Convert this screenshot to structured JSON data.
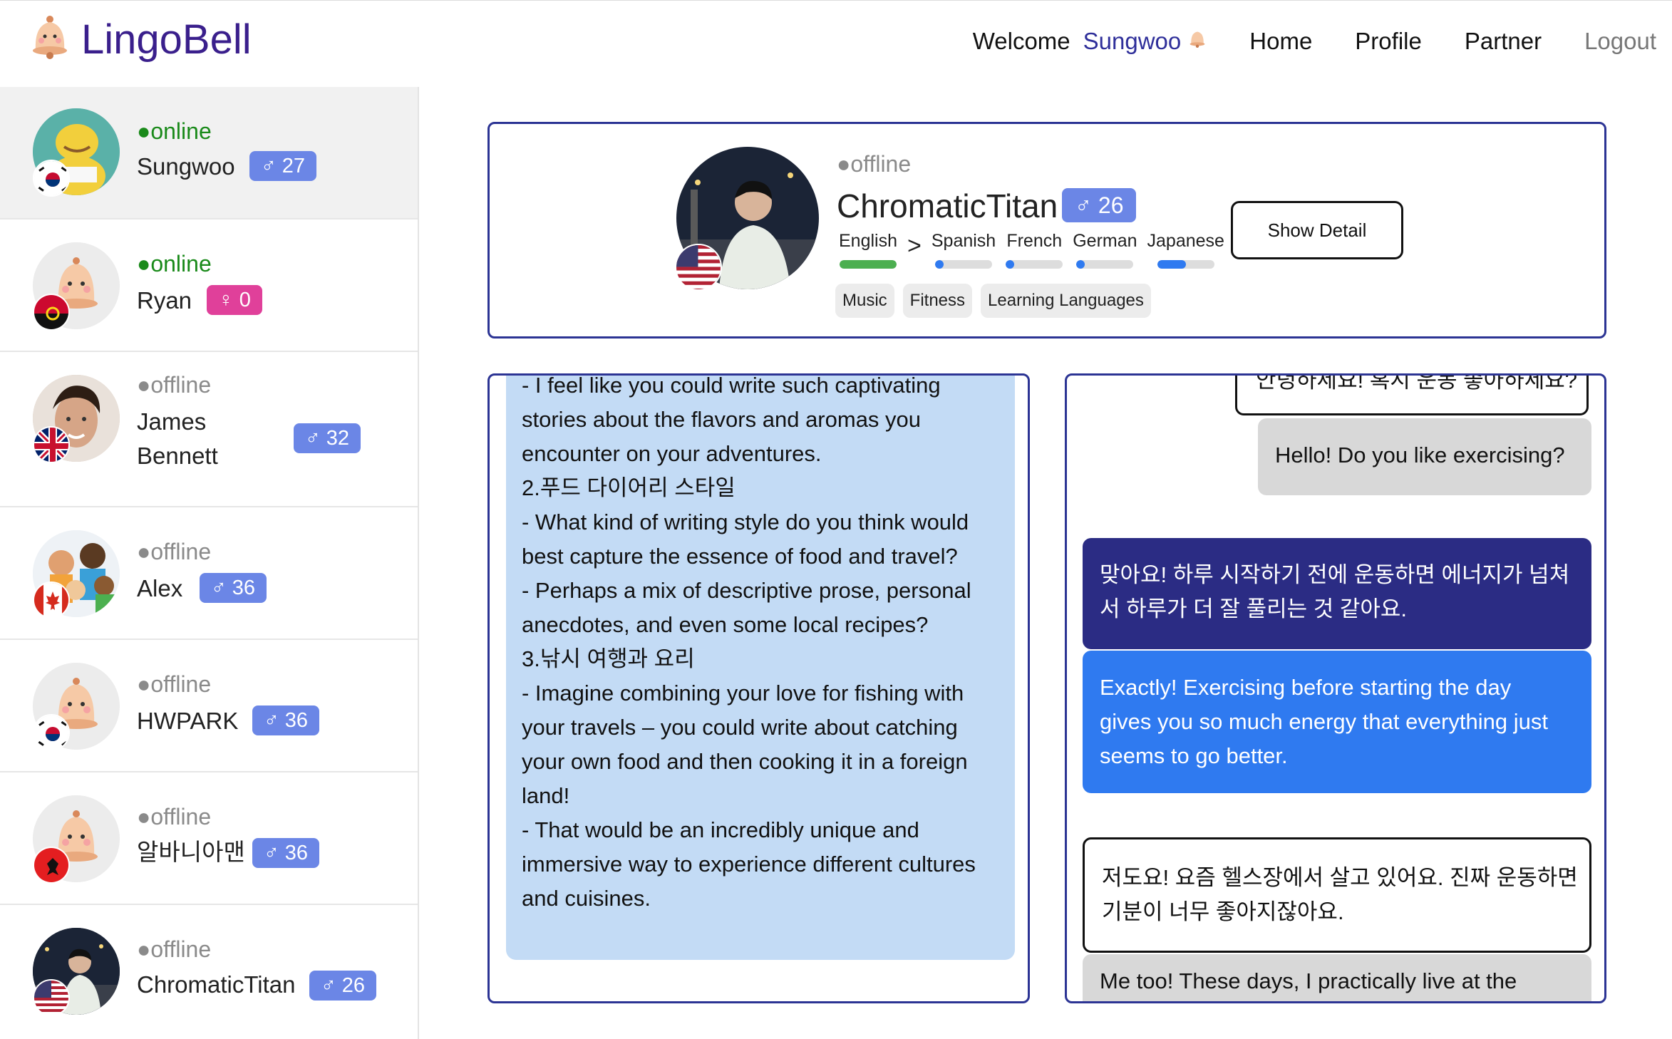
{
  "brand": {
    "name": "LingoBell",
    "logo_icon": "bell-icon"
  },
  "nav": {
    "welcome": "Welcome",
    "username": "Sungwoo",
    "home": "Home",
    "profile": "Profile",
    "partner": "Partner",
    "logout": "Logout"
  },
  "sidebar": {
    "items": [
      {
        "status": "●online",
        "name": "Sungwoo",
        "badge": "♂ 27",
        "flag": "korea"
      },
      {
        "status": "●online",
        "name": "Ryan",
        "badge": "♀ 0",
        "flag": "angola"
      },
      {
        "status": "●offline",
        "name": "James",
        "name2": "Bennett",
        "badge": "♂ 32",
        "flag": "uk"
      },
      {
        "status": "●offline",
        "name": "Alex",
        "badge": "♂ 36",
        "flag": "canada"
      },
      {
        "status": "●offline",
        "name": "HWPARK",
        "badge": "♂ 36",
        "flag": "korea"
      },
      {
        "status": "●offline",
        "name": "알바니아맨",
        "badge": "♂ 36",
        "flag": "albania"
      },
      {
        "status": "●offline",
        "name": "ChromaticTitan",
        "badge": "♂ 26",
        "flag": "usa"
      }
    ]
  },
  "partner": {
    "status": "●offline",
    "name": "ChromaticTitan",
    "badge": "♂ 26",
    "native_language": {
      "name": "English",
      "level": 1.0
    },
    "arrow": ">",
    "learning_languages": [
      {
        "name": "Spanish",
        "level": 0.15
      },
      {
        "name": "French",
        "level": 0.15
      },
      {
        "name": "German",
        "level": 0.15
      },
      {
        "name": "Japanese",
        "level": 0.5
      }
    ],
    "interests": [
      "Music",
      "Fitness",
      "Learning Languages"
    ],
    "show_detail": "Show Detail",
    "colors": {
      "native": "#4caf50",
      "learning": "#2f7af0"
    }
  },
  "left_panel": {
    "lines": [
      " - I feel like you could write such captivating",
      "stories about the flavors and aromas you",
      "encounter on your adventures.",
      " 2.푸드 다이어리 스타일",
      " - What kind of writing style do you think would",
      "best capture the essence of food and travel?",
      " - Perhaps a mix of descriptive prose, personal",
      "anecdotes, and even some local recipes?",
      " 3.낚시 여행과 요리",
      " - Imagine combining your love for fishing with",
      "your travels – you could write about catching",
      "your own food and then cooking it in a foreign",
      "land!",
      " - That would be an incredibly unique and",
      "immersive way to experience different cultures",
      "and cuisines."
    ]
  },
  "chat": {
    "m0": "안녕하세요! 혹시 운동 좋아하세요?",
    "m1": "Hello! Do you like exercising?",
    "m2a": "맞아요! 하루 시작하기 전에 운동하면 에너지가 넘쳐",
    "m2b": "서 하루가 더 잘 풀리는 것 같아요.",
    "m3a": "Exactly! Exercising before starting the day",
    "m3b": "gives you so much energy that everything just",
    "m3c": "seems to go better.",
    "m4a": "저도요! 요즘 헬스장에서 살고 있어요. 진짜 운동하면",
    "m4b": "기분이 너무 좋아지잖아요.",
    "m5": "Me too! These days, I practically live at the"
  }
}
